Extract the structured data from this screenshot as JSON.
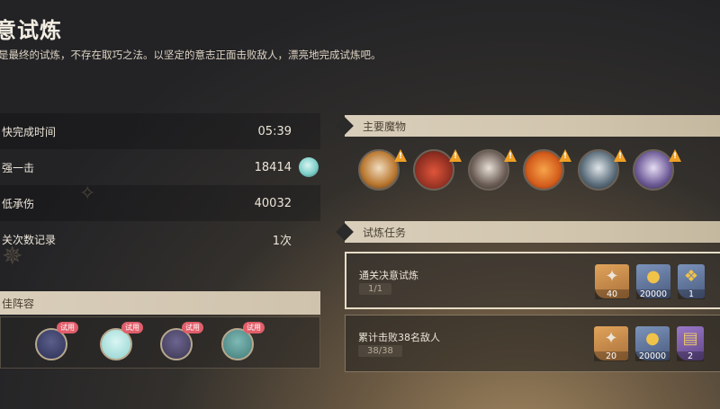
{
  "header": {
    "title": "意试炼",
    "subtitle": "是最终的试炼，不存在取巧之法。以坚定的意志正面击败敌人，漂亮地完成试炼吧。"
  },
  "stats": [
    {
      "label": "快完成时间",
      "value": "05:39"
    },
    {
      "label": "强一击",
      "value": "18414"
    },
    {
      "label": "低承伤",
      "value": "40032"
    },
    {
      "label": "关次数记录",
      "value": "1次"
    }
  ],
  "lineup": {
    "title": "佳阵容",
    "trial_tag": "试用",
    "members": [
      {
        "name": "member-1",
        "color": "#2b2f55"
      },
      {
        "name": "member-2",
        "color": "#8fd3cf"
      },
      {
        "name": "member-3",
        "color": "#3a3550"
      },
      {
        "name": "member-4",
        "color": "#3f7b79"
      }
    ]
  },
  "monsters": {
    "title": "主要魔物",
    "warning_mark": "!",
    "items": [
      {
        "name": "monster-1",
        "color": "#e9d2b4"
      },
      {
        "name": "monster-2",
        "color": "#c94a32"
      },
      {
        "name": "monster-3",
        "color": "#d8cfc6"
      },
      {
        "name": "monster-4",
        "color": "#e0752a"
      },
      {
        "name": "monster-5",
        "color": "#5a6c7a"
      },
      {
        "name": "monster-6",
        "color": "#6c5a96"
      }
    ]
  },
  "tasks": {
    "title": "试炼任务",
    "items": [
      {
        "name": "通关决意试炼",
        "progress": "1/1",
        "rewards": [
          {
            "type": "gold",
            "icon": "crystal-icon",
            "glyph": "✦",
            "amount": "40"
          },
          {
            "type": "blue",
            "icon": "coin-icon",
            "glyph": "●",
            "amount": "20000"
          },
          {
            "type": "blue",
            "icon": "feather-icon",
            "glyph": "❖",
            "amount": "1"
          }
        ]
      },
      {
        "name": "累计击败38名敌人",
        "progress": "38/38",
        "rewards": [
          {
            "type": "gold",
            "icon": "crystal-icon",
            "glyph": "✦",
            "amount": "20"
          },
          {
            "type": "blue",
            "icon": "coin-icon",
            "glyph": "●",
            "amount": "20000"
          },
          {
            "type": "purple",
            "icon": "book-icon",
            "glyph": "▤",
            "amount": "2"
          }
        ]
      }
    ]
  }
}
